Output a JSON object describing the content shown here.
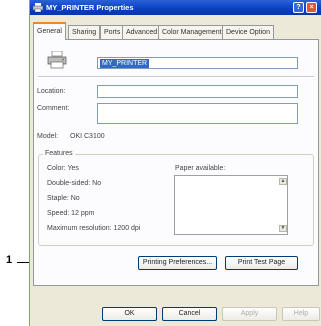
{
  "window": {
    "title": "MY_PRINTER Properties",
    "help": "?",
    "close": "×"
  },
  "tabs": [
    {
      "label": "General",
      "active": true
    },
    {
      "label": "Sharing"
    },
    {
      "label": "Ports"
    },
    {
      "label": "Advanced"
    },
    {
      "label": "Color Management"
    },
    {
      "label": "Device Option"
    }
  ],
  "general": {
    "printer_name": "MY_PRINTER",
    "location_label": "Location:",
    "location_value": "",
    "comment_label": "Comment:",
    "comment_value": "",
    "model_label": "Model:",
    "model_value": "OKI C3100"
  },
  "features": {
    "title": "Features",
    "color": "Color: Yes",
    "double_sided": "Double-sided: No",
    "staple": "Staple: No",
    "speed": "Speed: 12 ppm",
    "max_resolution": "Maximum resolution: 1200 dpi",
    "paper_available_label": "Paper available:",
    "paper_list": []
  },
  "buttons": {
    "printing_preferences": "Printing Preferences...",
    "print_test_page": "Print Test Page",
    "ok": "OK",
    "cancel": "Cancel",
    "apply": "Apply",
    "help": "Help"
  },
  "callout": {
    "number": "1"
  }
}
